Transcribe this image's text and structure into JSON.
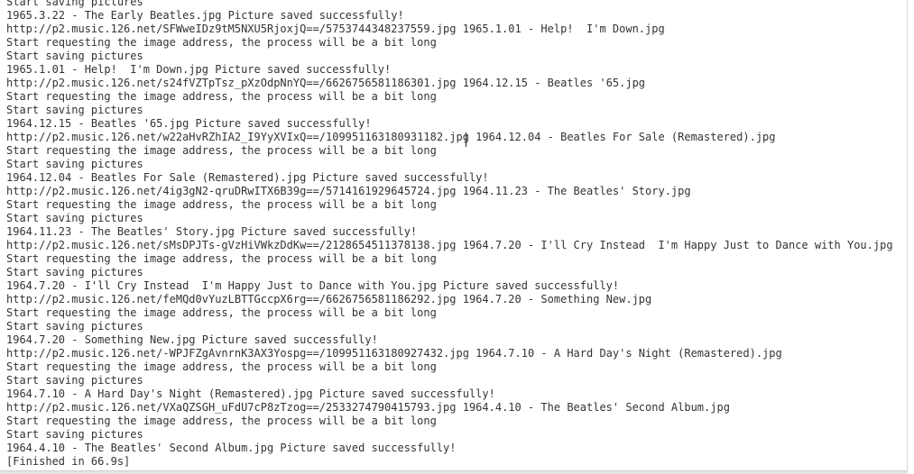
{
  "console": {
    "lines": [
      "Start saving pictures",
      "1965.3.22 - The Early Beatles.jpg Picture saved successfully!",
      "http://p2.music.126.net/SFWweIDz9tM5NXU5RjoxjQ==/5753744348237559.jpg 1965.1.01 - Help!  I'm Down.jpg",
      "Start requesting the image address, the process will be a bit long",
      "Start saving pictures",
      "1965.1.01 - Help!  I'm Down.jpg Picture saved successfully!",
      "http://p2.music.126.net/s24fVZTpTsz_pXzOdpNnYQ==/6626756581186301.jpg 1964.12.15 - Beatles '65.jpg",
      "Start requesting the image address, the process will be a bit long",
      "Start saving pictures",
      "1964.12.15 - Beatles '65.jpg Picture saved successfully!",
      "http://p2.music.126.net/w22aHvRZhIA2_I9YyXVIxQ==/109951163180931182.jpg 1964.12.04 - Beatles For Sale (Remastered).jpg",
      "Start requesting the image address, the process will be a bit long",
      "Start saving pictures",
      "1964.12.04 - Beatles For Sale (Remastered).jpg Picture saved successfully!",
      "http://p2.music.126.net/4ig3gN2-qruDRwITX6B39g==/5714161929645724.jpg 1964.11.23 - The Beatles' Story.jpg",
      "Start requesting the image address, the process will be a bit long",
      "Start saving pictures",
      "1964.11.23 - The Beatles' Story.jpg Picture saved successfully!",
      "http://p2.music.126.net/sMsDPJTs-gVzHiVWkzDdKw==/2128654511378138.jpg 1964.7.20 - I'll Cry Instead  I'm Happy Just to Dance with You.jpg",
      "Start requesting the image address, the process will be a bit long",
      "Start saving pictures",
      "1964.7.20 - I'll Cry Instead  I'm Happy Just to Dance with You.jpg Picture saved successfully!",
      "http://p2.music.126.net/feMQd0vYuzLBTTGccpX6rg==/6626756581186292.jpg 1964.7.20 - Something New.jpg",
      "Start requesting the image address, the process will be a bit long",
      "Start saving pictures",
      "1964.7.20 - Something New.jpg Picture saved successfully!",
      "http://p2.music.126.net/-WPJFZgAvnrnK3AX3Yospg==/109951163180927432.jpg 1964.7.10 - A Hard Day's Night (Remastered).jpg",
      "Start requesting the image address, the process will be a bit long",
      "Start saving pictures",
      "1964.7.10 - A Hard Day's Night (Remastered).jpg Picture saved successfully!",
      "http://p2.music.126.net/VXaQZSGH_uFdU7cP8zTzog==/2533274790415793.jpg 1964.4.10 - The Beatles' Second Album.jpg",
      "Start requesting the image address, the process will be a bit long",
      "Start saving pictures",
      "1964.4.10 - The Beatles' Second Album.jpg Picture saved successfully!",
      "[Finished in 66.9s]"
    ]
  }
}
